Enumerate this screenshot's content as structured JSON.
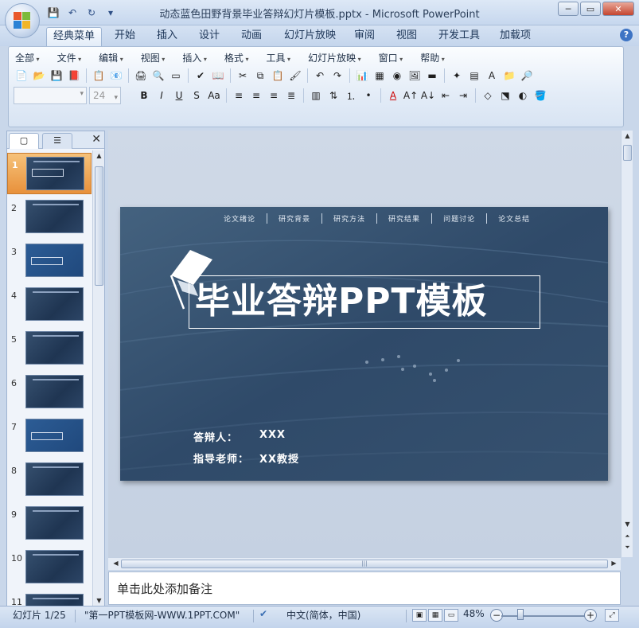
{
  "window": {
    "title": "动态蓝色田野背景毕业答辩幻灯片模板.pptx - Microsoft PowerPoint",
    "minimize": "─",
    "maximize": "▭",
    "close": "✕"
  },
  "quick_access": {
    "save_icon": "💾",
    "undo_icon": "↶",
    "redo_icon": "↻",
    "more_icon": "▾"
  },
  "tabs": [
    "经典菜单",
    "开始",
    "插入",
    "设计",
    "动画",
    "幻灯片放映",
    "审阅",
    "视图",
    "开发工具",
    "加载项"
  ],
  "active_tab": "经典菜单",
  "help_label": "?",
  "menu": [
    "全部",
    "文件",
    "编辑",
    "视图",
    "插入",
    "格式",
    "工具",
    "幻灯片放映",
    "窗口",
    "帮助"
  ],
  "format": {
    "font_name": "",
    "font_size": "24"
  },
  "panel": {
    "tab_slides_icon": "▢",
    "tab_outline_icon": "☰",
    "close_label": "✕",
    "slides": [
      {
        "num": "1"
      },
      {
        "num": "2"
      },
      {
        "num": "3"
      },
      {
        "num": "4"
      },
      {
        "num": "5"
      },
      {
        "num": "6"
      },
      {
        "num": "7"
      },
      {
        "num": "8"
      },
      {
        "num": "9"
      },
      {
        "num": "10"
      },
      {
        "num": "11"
      }
    ]
  },
  "slide": {
    "nav": [
      "论文绪论",
      "研究背景",
      "研究方法",
      "研究结果",
      "问题讨论",
      "论文总结"
    ],
    "title": "毕业答辩PPT模板",
    "presenter_label": "答辩人：",
    "presenter_value": "XXX",
    "advisor_label": "指导老师：",
    "advisor_value": "XX教授"
  },
  "notes_placeholder": "单击此处添加备注",
  "status": {
    "slide_count": "幻灯片 1/25",
    "theme": "\"第一PPT模板网-WWW.1PPT.COM\"",
    "language": "中文(简体，中国)",
    "zoom": "48%"
  },
  "colors": {
    "slide_bg": "#314c6c",
    "ribbon_bg": "#e3ecf7",
    "selected_thumb": "#e8913b"
  }
}
